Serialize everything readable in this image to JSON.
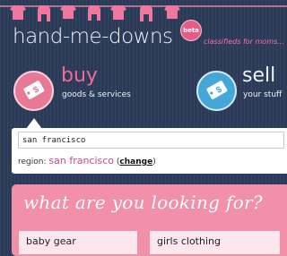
{
  "header": {
    "logo_text": "hand-me-downs",
    "beta_badge": "beta",
    "tagline": "classifieds for moms..."
  },
  "modes": {
    "buy": {
      "title": "buy",
      "subtitle": "goods & services",
      "icon": "tag-dollar-icon",
      "color": "#e77896"
    },
    "sell": {
      "title": "sell",
      "subtitle": "your stuff",
      "icon": "price-tag-icon",
      "color": "#44a7d8"
    }
  },
  "search": {
    "value": "san francisco"
  },
  "region": {
    "label": "region:",
    "name": "san francisco",
    "change_link": "change"
  },
  "categories": {
    "heading": "what are you looking for?",
    "items": [
      "baby gear",
      "girls clothing"
    ]
  },
  "colors": {
    "background": "#2a3a57",
    "accent_pink": "#f06c96",
    "accent_blue": "#44a7d8",
    "panel_pink": "#f28fa9"
  }
}
